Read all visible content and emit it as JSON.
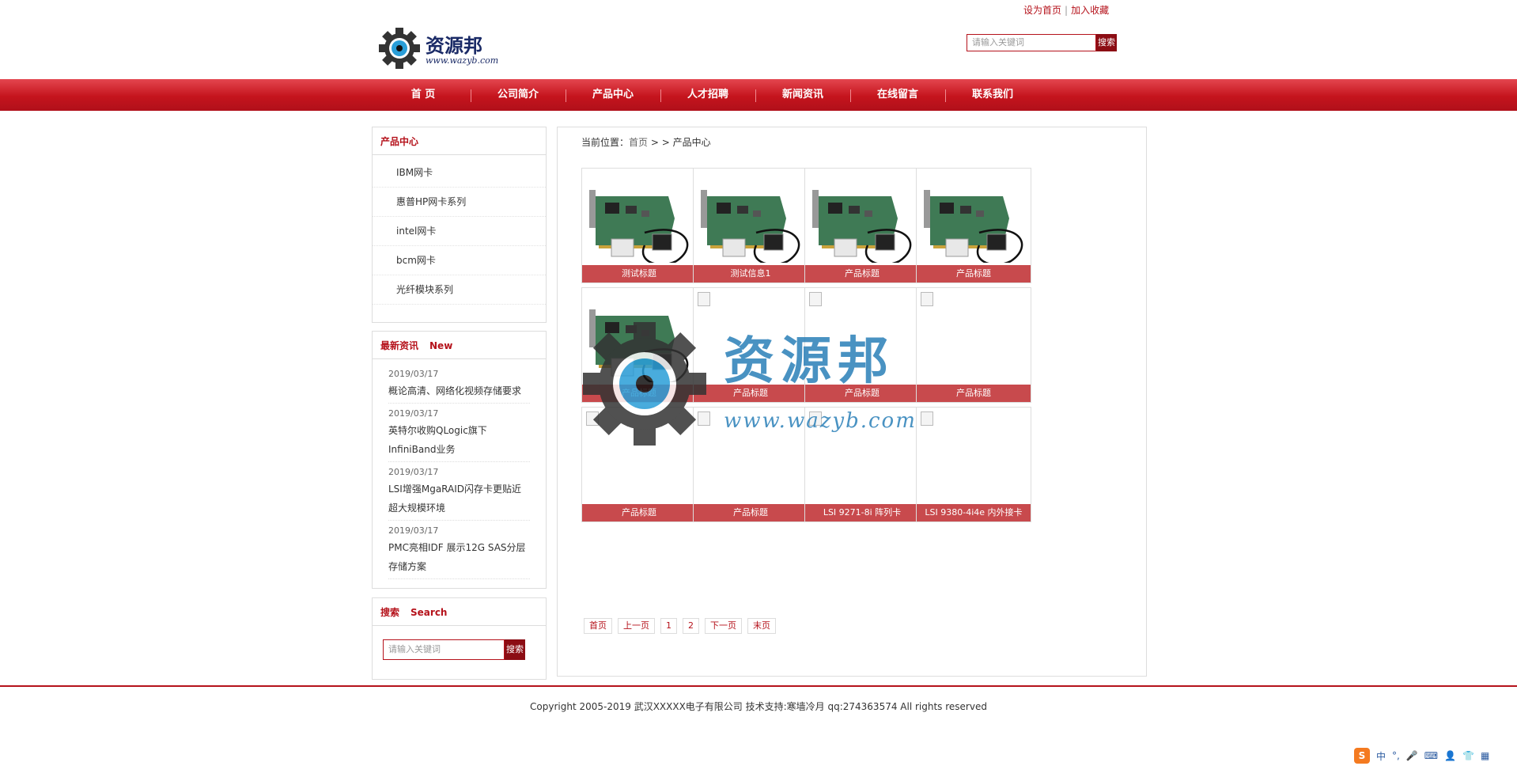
{
  "header": {
    "set_home": "设为首页",
    "separator": "|",
    "add_favorite": "加入收藏",
    "logo_text": "资源邦",
    "logo_url": "www.wazyb.com",
    "search_placeholder": "请输入关键词",
    "search_button": "搜索"
  },
  "nav": [
    "首 页",
    "公司简介",
    "产品中心",
    "人才招聘",
    "新闻资讯",
    "在线留言",
    "联系我们"
  ],
  "sidebar": {
    "products_title": "产品中心",
    "categories": [
      "IBM网卡",
      "惠普HP网卡系列",
      "intel网卡",
      "bcm网卡",
      "光纤模块系列"
    ],
    "news_title": "最新资讯",
    "news_title_en": "New",
    "news": [
      {
        "date": "2019/03/17",
        "title": "概论高清、网络化视频存储要求"
      },
      {
        "date": "2019/03/17",
        "title": "英特尔收购QLogic旗下InfiniBand业务"
      },
      {
        "date": "2019/03/17",
        "title": "LSI增强MgaRAID闪存卡更贴近超大规模环境"
      },
      {
        "date": "2019/03/17",
        "title": "PMC亮相IDF 展示12G SAS分层存储方案"
      }
    ],
    "search_title": "搜索",
    "search_title_en": "Search",
    "search_placeholder": "请输入关键词",
    "search_button": "搜索"
  },
  "breadcrumb": {
    "prefix": "当前位置：",
    "home": "首页",
    "separator": " > > ",
    "current": "产品中心"
  },
  "products": [
    {
      "title": "测试标题",
      "image": "product-photo"
    },
    {
      "title": "测试信息1",
      "image": "product-photo"
    },
    {
      "title": "产品标题",
      "image": "product-photo"
    },
    {
      "title": "产品标题",
      "image": "product-photo"
    },
    {
      "title": "产品标题",
      "image": "product-photo"
    },
    {
      "title": "产品标题",
      "image": "broken"
    },
    {
      "title": "产品标题",
      "image": "broken"
    },
    {
      "title": "产品标题",
      "image": "broken"
    },
    {
      "title": "产品标题",
      "image": "broken"
    },
    {
      "title": "产品标题",
      "image": "broken"
    },
    {
      "title": "LSI 9271-8i 阵列卡",
      "image": "broken"
    },
    {
      "title": "LSI 9380-4i4e 内外接卡",
      "image": "broken"
    }
  ],
  "pager": [
    "首页",
    "上一页",
    "1",
    "2",
    "下一页",
    "末页"
  ],
  "watermark": {
    "text": "资源邦",
    "url": "www.wazyb.com"
  },
  "footer": {
    "copyright": "Copyright 2005-2019 武汉XXXXX电子有限公司 技术支持:寒墙冷月 qq:274363574 All rights reserved"
  },
  "ime": {
    "logo": "S",
    "lang": "中",
    "punct": "°,"
  },
  "colors": {
    "brand_red": "#b5121b",
    "caption_red": "#c84a4d",
    "logo_blue": "#2a7fb8"
  }
}
